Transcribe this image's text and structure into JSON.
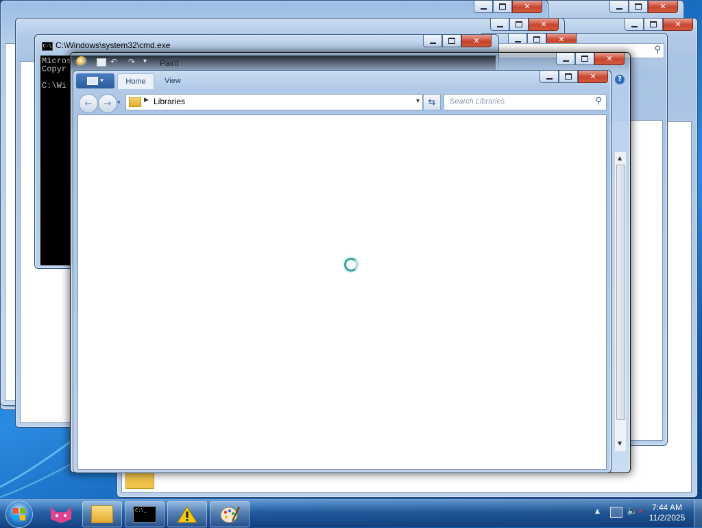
{
  "windows": {
    "cmd": {
      "title": "C:\\Windows\\system32\\cmd.exe",
      "lines": [
        "Micros",
        "Copyr",
        "",
        "C:\\Wi"
      ]
    },
    "paint": {
      "title": "Paint",
      "ribbon_tabs": [
        "Home",
        "View"
      ]
    },
    "explorer": {
      "address": "Libraries",
      "search_placeholder": "Search Libraries"
    }
  },
  "taskbar": {
    "items": [
      {
        "name": "start-button",
        "icon": "windows-orb-icon"
      },
      {
        "name": "taskbar-app-cat",
        "icon": "cat-app-icon"
      },
      {
        "name": "taskbar-explorer",
        "icon": "folder-icon"
      },
      {
        "name": "taskbar-cmd",
        "icon": "cmd-icon"
      },
      {
        "name": "taskbar-warning",
        "icon": "warning-icon"
      },
      {
        "name": "taskbar-paint",
        "icon": "paint-icon"
      }
    ],
    "clock_time": "7:44 AM",
    "clock_date": "11/2/2025"
  },
  "colors": {
    "close_button": "#c7452f",
    "taskbar": "#1c4f8c",
    "desktop": "#1b6fc4"
  }
}
